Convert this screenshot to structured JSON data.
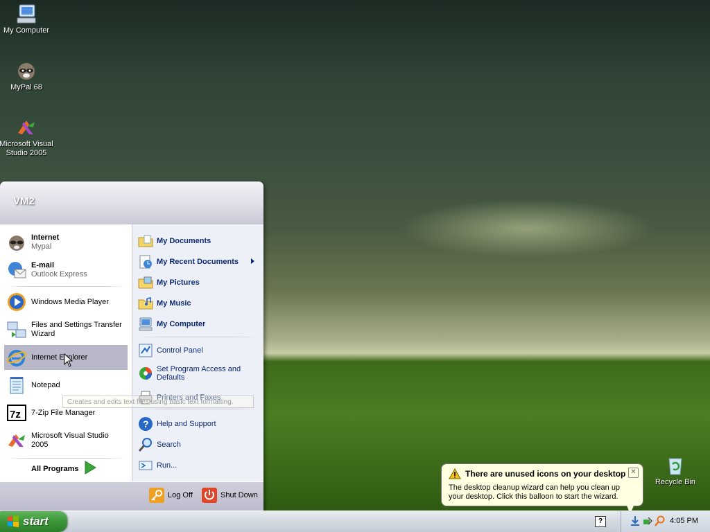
{
  "desktop": {
    "icons": [
      {
        "label": "My Computer"
      },
      {
        "label": "MyPal 68"
      },
      {
        "label": "Microsoft Visual Studio 2005"
      },
      {
        "label": "Recycle Bin"
      }
    ]
  },
  "start_menu": {
    "user_name": "VM2",
    "pinned": [
      {
        "title": "Internet",
        "subtitle": "Mypal"
      },
      {
        "title": "E-mail",
        "subtitle": "Outlook Express"
      }
    ],
    "recent": [
      {
        "label": "Windows Media Player"
      },
      {
        "label": "Files and Settings Transfer Wizard"
      },
      {
        "label": "Internet Explorer"
      },
      {
        "label": "Notepad"
      },
      {
        "label": "7-Zip File Manager"
      },
      {
        "label": "Microsoft Visual Studio 2005"
      }
    ],
    "all_programs": "All Programs",
    "tooltip": "Creates and edits text files using basic text formatting.",
    "right_items": [
      {
        "label": "My Documents"
      },
      {
        "label": "My Recent Documents"
      },
      {
        "label": "My Pictures"
      },
      {
        "label": "My Music"
      },
      {
        "label": "My Computer"
      },
      {
        "label": "Control Panel"
      },
      {
        "label": "Set Program Access and Defaults"
      },
      {
        "label": "Printers and Faxes"
      },
      {
        "label": "Help and Support"
      },
      {
        "label": "Search"
      },
      {
        "label": "Run..."
      }
    ],
    "log_off": "Log Off",
    "shut_down": "Shut Down"
  },
  "taskbar": {
    "start_label": "start",
    "clock": "4:05 PM"
  },
  "balloon": {
    "title": "There are unused icons on your desktop",
    "text": "The desktop cleanup wizard can help you clean up your desktop. Click this balloon to start the wizard."
  }
}
